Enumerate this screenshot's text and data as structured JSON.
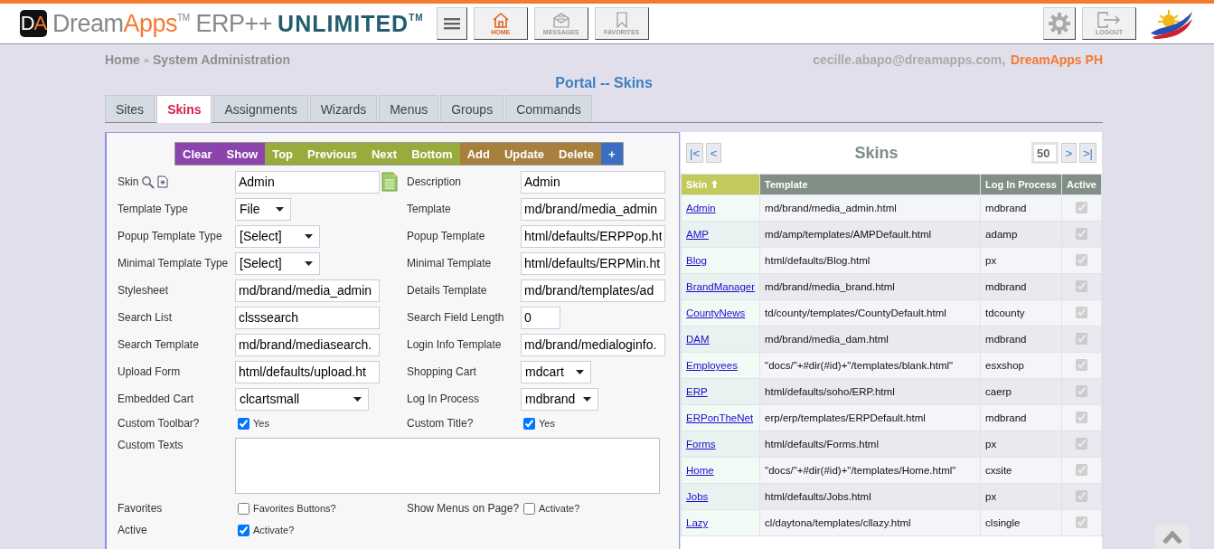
{
  "header": {
    "logo": {
      "badge_a": "D",
      "badge_b": "A",
      "name_a": "Dream",
      "name_b": "Apps",
      "tm": "TM",
      "product": "ERP++",
      "edition": "UNLIMITED",
      "edition_tm": "TM"
    },
    "nav": [
      {
        "kind": "menu"
      },
      {
        "kind": "home",
        "label": "HOME",
        "selected": true
      },
      {
        "kind": "messages",
        "label": "MESSAGES",
        "selected": false
      },
      {
        "kind": "favorites",
        "label": "FAVORITES",
        "selected": false
      }
    ],
    "tools": [
      {
        "kind": "settings"
      },
      {
        "kind": "logout",
        "label": "LOGOUT"
      }
    ]
  },
  "breadcrumb": {
    "items": [
      "Home",
      "System Administration"
    ],
    "separator": "»"
  },
  "user": {
    "email": "cecille.abapo@dreamapps.com,",
    "company": "DreamApps PH"
  },
  "page_title": "Portal -- Skins",
  "tabs": [
    {
      "label": "Sites",
      "selected": false
    },
    {
      "label": "Skins",
      "selected": true
    },
    {
      "label": "Assignments",
      "selected": false
    },
    {
      "label": "Wizards",
      "selected": false
    },
    {
      "label": "Menus",
      "selected": false
    },
    {
      "label": "Groups",
      "selected": false
    },
    {
      "label": "Commands",
      "selected": false
    }
  ],
  "toolbar": [
    {
      "label": "Clear",
      "color": "#8b44ac"
    },
    {
      "label": "Show",
      "color": "#8b44ac"
    },
    {
      "label": "Top",
      "color": "#9aab3e"
    },
    {
      "label": "Previous",
      "color": "#9aab3e"
    },
    {
      "label": "Next",
      "color": "#9aab3e"
    },
    {
      "label": "Bottom",
      "color": "#9aab3e"
    },
    {
      "label": "Add",
      "color": "#a8803e"
    },
    {
      "label": "Update",
      "color": "#a8803e"
    },
    {
      "label": "Delete",
      "color": "#a8803e"
    },
    {
      "label": "+",
      "color": "#3c6fc4"
    }
  ],
  "form": {
    "rows": [
      {
        "left": {
          "label": "Skin",
          "kind": "lookup",
          "value": "Admin"
        },
        "right": {
          "label": "Description",
          "kind": "text",
          "value": "Admin"
        }
      },
      {
        "left": {
          "label": "Template Type",
          "kind": "select",
          "value": "File"
        },
        "right": {
          "label": "Template",
          "kind": "text",
          "value": "md/brand/media_admin"
        }
      },
      {
        "left": {
          "label": "Popup Template Type",
          "kind": "select",
          "value": "[Select]"
        },
        "right": {
          "label": "Popup Template",
          "kind": "text",
          "value": "html/defaults/ERPPop.ht"
        }
      },
      {
        "left": {
          "label": "Minimal Template Type",
          "kind": "select",
          "value": "[Select]"
        },
        "right": {
          "label": "Minimal Template",
          "kind": "text",
          "value": "html/defaults/ERPMin.ht"
        }
      },
      {
        "left": {
          "label": "Stylesheet",
          "kind": "text",
          "value": "md/brand/media_admin"
        },
        "right": {
          "label": "Details Template",
          "kind": "text",
          "value": "md/brand/templates/ad"
        }
      },
      {
        "left": {
          "label": "Search List",
          "kind": "text",
          "value": "clsssearch"
        },
        "right": {
          "label": "Search Field Length",
          "kind": "short",
          "value": "0"
        }
      },
      {
        "left": {
          "label": "Search Template",
          "kind": "text",
          "value": "md/brand/mediasearch."
        },
        "right": {
          "label": "Login Info Template",
          "kind": "text",
          "value": "md/brand/medialoginfo."
        }
      },
      {
        "left": {
          "label": "Upload Form",
          "kind": "text",
          "value": "html/defaults/upload.ht"
        },
        "right": {
          "label": "Shopping Cart",
          "kind": "select",
          "value": "mdcart"
        }
      },
      {
        "left": {
          "label": "Embedded Cart",
          "kind": "select",
          "value": "clcartsmall"
        },
        "right": {
          "label": "Log In Process",
          "kind": "select",
          "value": "mdbrand"
        }
      },
      {
        "left": {
          "label": "Custom Toolbar?",
          "kind": "checkbox",
          "text": "Yes",
          "checked": true
        },
        "right": {
          "label": "Custom Title?",
          "kind": "checkbox",
          "text": "Yes",
          "checked": true
        }
      },
      {
        "left": {
          "label": "Custom Texts",
          "kind": "textarea"
        }
      },
      {
        "left": {
          "label": "Favorites",
          "kind": "checkbox",
          "text": "Favorites Buttons?",
          "checked": false
        },
        "right": {
          "label": "Show Menus on Page?",
          "kind": "checkbox",
          "text": "Activate?",
          "checked": false
        }
      },
      {
        "left": {
          "label": "Active",
          "kind": "checkbox",
          "text": "Activate?",
          "checked": true
        }
      }
    ]
  },
  "table": {
    "title": "Skins",
    "page_size": "50",
    "first": "|<",
    "prev": "<",
    "next": ">",
    "last": ">|",
    "columns": [
      {
        "label": "Skin",
        "sorted": true
      },
      {
        "label": "Template",
        "sorted": false
      },
      {
        "label": "Log In Process",
        "sorted": false
      },
      {
        "label": "Active",
        "sorted": false
      }
    ],
    "rows": [
      {
        "skin": "Admin",
        "template": "md/brand/media_admin.html",
        "process": "mdbrand",
        "active": true
      },
      {
        "skin": "AMP",
        "template": "md/amp/templates/AMPDefault.html",
        "process": "adamp",
        "active": true
      },
      {
        "skin": "Blog",
        "template": "html/defaults/Blog.html",
        "process": "px",
        "active": true
      },
      {
        "skin": "BrandManager",
        "template": "md/brand/media_brand.html",
        "process": "mdbrand",
        "active": true
      },
      {
        "skin": "CountyNews",
        "template": "td/county/templates/CountyDefault.html",
        "process": "tdcounty",
        "active": true
      },
      {
        "skin": "DAM",
        "template": "md/brand/media_dam.html",
        "process": "mdbrand",
        "active": true
      },
      {
        "skin": "Employees",
        "template": "\"docs/\"+#dir(#id)+\"/templates/blank.html\"",
        "process": "esxshop",
        "active": true
      },
      {
        "skin": "ERP",
        "template": "html/defaults/soho/ERP.html",
        "process": "caerp",
        "active": true
      },
      {
        "skin": "ERPonTheNet",
        "template": "erp/erp/templates/ERPDefault.html",
        "process": "mdbrand",
        "active": true
      },
      {
        "skin": "Forms",
        "template": "html/defaults/Forms.html",
        "process": "px",
        "active": true
      },
      {
        "skin": "Home",
        "template": "\"docs/\"+#dir(#id)+\"/templates/Home.html\"",
        "process": "cxsite",
        "active": true
      },
      {
        "skin": "Jobs",
        "template": "html/defaults/Jobs.html",
        "process": "px",
        "active": true
      },
      {
        "skin": "Lazy",
        "template": "cl/daytona/templates/cllazy.html",
        "process": "clsingle",
        "active": true
      }
    ]
  }
}
